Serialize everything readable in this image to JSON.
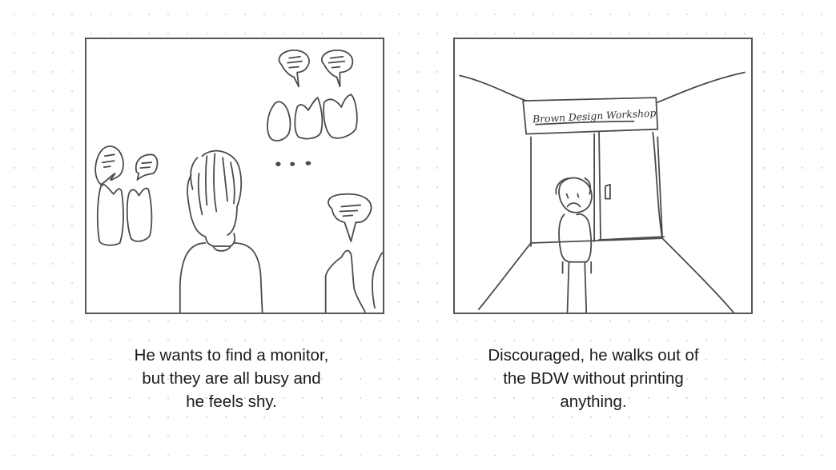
{
  "panels": [
    {
      "caption": "He wants to find a monitor,\nbut they are all busy and\nhe feels shy."
    },
    {
      "caption": "Discouraged, he walks out of\nthe BDW without printing\nanything.",
      "sign_text": "Brown Design Workshop"
    }
  ]
}
